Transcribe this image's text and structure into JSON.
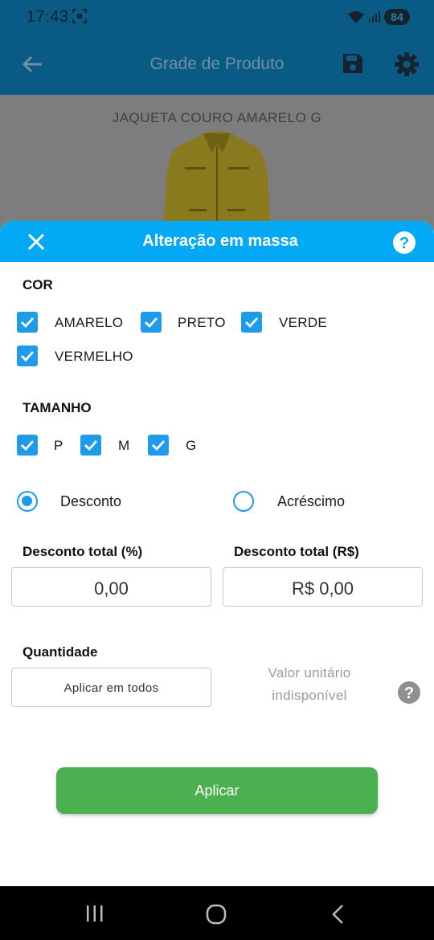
{
  "status": {
    "time": "17:43",
    "battery": "84"
  },
  "app_bar": {
    "title": "Grade de Produto"
  },
  "product": {
    "name": "JAQUETA COURO AMARELO G"
  },
  "sheet": {
    "title": "Alteração em massa"
  },
  "color_section": {
    "label": "COR",
    "options": [
      {
        "label": "AMARELO",
        "checked": true
      },
      {
        "label": "PRETO",
        "checked": true
      },
      {
        "label": "VERDE",
        "checked": true
      },
      {
        "label": "VERMELHO",
        "checked": true
      }
    ]
  },
  "size_section": {
    "label": "TAMANHO",
    "options": [
      {
        "label": "P",
        "checked": true
      },
      {
        "label": "M",
        "checked": true
      },
      {
        "label": "G",
        "checked": true
      }
    ]
  },
  "adjustment_type": {
    "options": [
      {
        "label": "Desconto",
        "selected": true
      },
      {
        "label": "Acréscimo",
        "selected": false
      }
    ]
  },
  "discount_percent": {
    "label": "Desconto total (%)",
    "value": "0,00"
  },
  "discount_value": {
    "label": "Desconto total (R$)",
    "value": "R$ 0,00"
  },
  "quantity": {
    "label": "Quantidade",
    "placeholder": "Aplicar em todos",
    "unit_value_unavailable_line1": "Valor unitário",
    "unit_value_unavailable_line2": "indisponível"
  },
  "apply_button": {
    "label": "Aplicar"
  },
  "colors": {
    "accent": "#03a9f4",
    "check": "#1e9ceb",
    "apply": "#4caf50",
    "app_bar": "#0a5a86"
  }
}
